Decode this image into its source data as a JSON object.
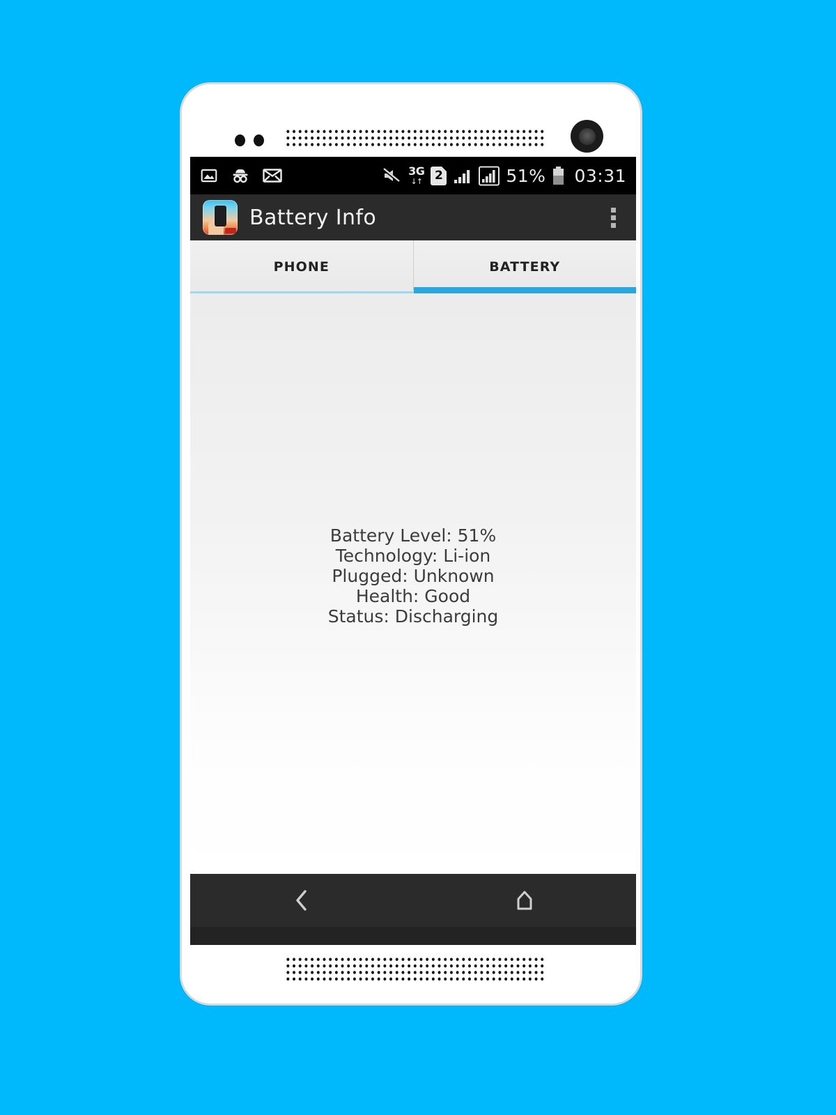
{
  "page": {
    "background_color": "#00b8fc"
  },
  "device": {
    "frame_color": "#ffffff",
    "bezel_border_color": "#d8dadc",
    "top_speaker_grille": "speaker-grille",
    "bottom_speaker_grille": "speaker-grille",
    "camera": "front-camera-lens",
    "sensors": [
      "proximity-sensor",
      "light-sensor"
    ]
  },
  "status_bar": {
    "background_color": "#000000",
    "left_icons": [
      {
        "name": "gallery-icon",
        "label": "Image"
      },
      {
        "name": "incognito-icon",
        "label": "Incognito"
      },
      {
        "name": "mail-icon",
        "label": "Mail"
      }
    ],
    "right_icons": [
      {
        "name": "mute-icon",
        "label": "Silent"
      },
      {
        "name": "network-3g-icon",
        "label": "3G"
      },
      {
        "name": "sim-2-icon",
        "label": "2"
      },
      {
        "name": "signal-bars-sim1-icon",
        "label": "Signal 1"
      },
      {
        "name": "signal-bars-sim2-icon",
        "label": "Signal 2"
      },
      {
        "name": "battery-icon",
        "label": "Battery"
      }
    ],
    "network_type": "3G",
    "network_arrows": "↓↑",
    "sim_slot": "2",
    "battery_percent": "51%",
    "clock": "03:31"
  },
  "app_bar": {
    "background_color": "#2b2b2b",
    "icon_name": "battery-info-app-icon",
    "title": "Battery Info",
    "overflow_menu_label": "More options"
  },
  "tabs": {
    "active_indicator_color": "#2aa8dd",
    "inactive_indicator_color": "#9dd9f2",
    "items": [
      {
        "id": "phone",
        "label": "PHONE",
        "active": false
      },
      {
        "id": "battery",
        "label": "BATTERY",
        "active": true
      }
    ]
  },
  "content": {
    "battery_info": [
      "Battery Level: 51%",
      "Technology: Li-ion",
      "Plugged: Unknown",
      "Health: Good",
      "Status: Discharging"
    ],
    "fields": {
      "battery_level": "51%",
      "technology": "Li-ion",
      "plugged": "Unknown",
      "health": "Good",
      "status": "Discharging"
    }
  },
  "nav_bar": {
    "background_color": "#2b2b2b",
    "buttons": [
      {
        "name": "back-button",
        "label": "Back"
      },
      {
        "name": "home-button",
        "label": "Home"
      }
    ]
  }
}
